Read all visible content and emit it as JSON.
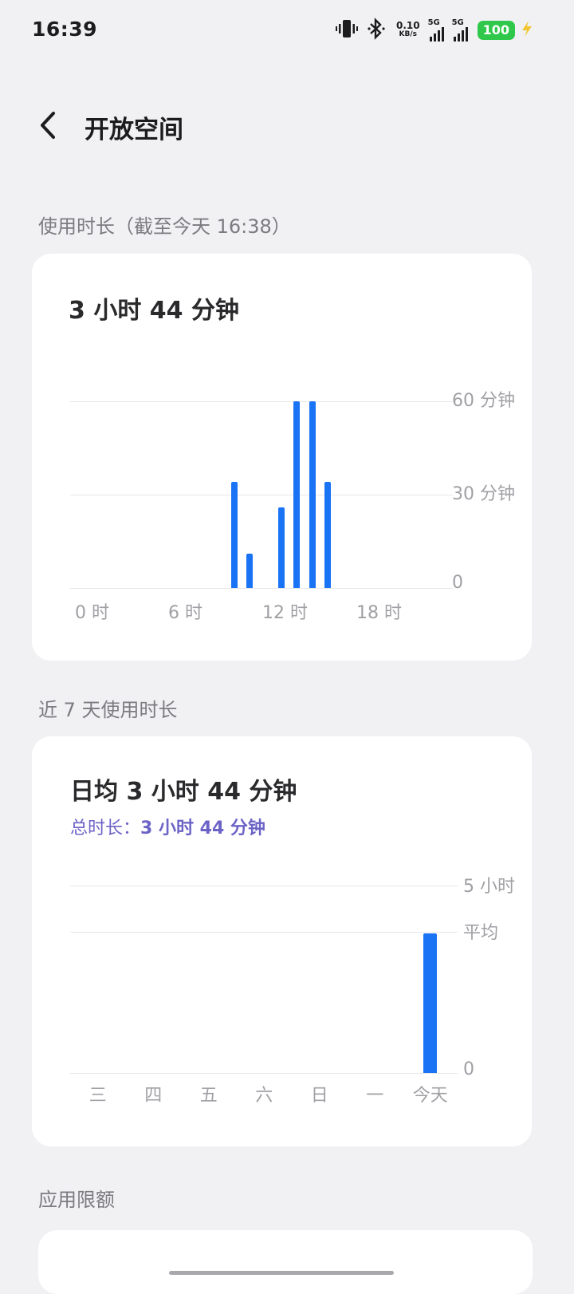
{
  "status_bar": {
    "time": "16:39",
    "net_speed_value": "0.10",
    "net_speed_unit": "KB/s",
    "sim1_label": "5G",
    "sim2_label": "5G",
    "battery": "100",
    "icons": [
      "vibrate-icon",
      "bluetooth-icon",
      "signal-icon",
      "battery-icon",
      "charging-icon"
    ]
  },
  "header": {
    "title": "开放空间"
  },
  "usage_today": {
    "section_label": "使用时长（截至今天 16:38）",
    "total": "3 小时 44 分钟",
    "y_labels": [
      "60 分钟",
      "30 分钟",
      "0"
    ],
    "x_labels": [
      "0 时",
      "6 时",
      "12 时",
      "18 时"
    ]
  },
  "usage_week": {
    "section_label": "近 7 天使用时长",
    "daily_avg": "日均 3 小时 44 分钟",
    "total_label": "总时长：",
    "total_value": "3 小时 44 分钟",
    "y_labels": [
      "5 小时",
      "平均",
      "0"
    ],
    "x_labels": [
      "三",
      "四",
      "五",
      "六",
      "日",
      "一",
      "今天"
    ]
  },
  "app_limit": {
    "section_label": "应用限额"
  },
  "colors": {
    "bar": "#1a73f5",
    "battery": "#2fc84a",
    "accent": "#6c63c6"
  },
  "chart_data": [
    {
      "type": "bar",
      "categories": [
        "0",
        "1",
        "2",
        "3",
        "4",
        "5",
        "6",
        "7",
        "8",
        "9",
        "10",
        "11",
        "12",
        "13",
        "14",
        "15",
        "16",
        "17",
        "18",
        "19",
        "20",
        "21",
        "22",
        "23"
      ],
      "values": [
        0,
        0,
        0,
        0,
        0,
        0,
        0,
        0,
        0,
        0,
        34,
        11,
        0,
        26,
        60,
        60,
        34,
        0,
        0,
        0,
        0,
        0,
        0,
        0
      ],
      "ylim": [
        0,
        60
      ]
    },
    {
      "type": "bar",
      "categories": [
        "三",
        "四",
        "五",
        "六",
        "日",
        "一",
        "今天"
      ],
      "values": [
        0,
        0,
        0,
        0,
        0,
        0,
        3.73
      ],
      "average": 3.73,
      "ylim": [
        0,
        5
      ]
    }
  ]
}
